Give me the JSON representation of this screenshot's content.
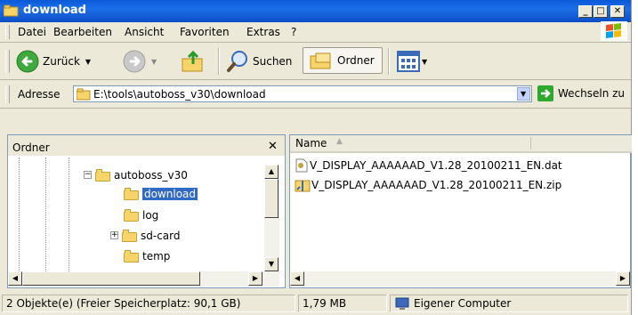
{
  "window": {
    "title": "download"
  },
  "menu": {
    "items": [
      {
        "label": "Datei"
      },
      {
        "label": "Bearbeiten"
      },
      {
        "label": "Ansicht"
      },
      {
        "label": "Favoriten"
      },
      {
        "label": "Extras"
      },
      {
        "label": "?"
      }
    ]
  },
  "toolbar": {
    "back": "Zurück",
    "search": "Suchen",
    "folders": "Ordner"
  },
  "address": {
    "label": "Adresse",
    "value": "E:\\tools\\autoboss_v30\\download",
    "go": "Wechseln zu"
  },
  "folderpane": {
    "title": "Ordner",
    "items": [
      {
        "label": "autoboss_v30",
        "expander": "−"
      },
      {
        "label": "download"
      },
      {
        "label": "log"
      },
      {
        "label": "sd-card",
        "expander": "+"
      },
      {
        "label": "temp"
      }
    ]
  },
  "list": {
    "column": "Name",
    "files": [
      {
        "name": "V_DISPLAY_AAAAAAD_V1.28_20100211_EN.dat",
        "icon": "dat-file-icon"
      },
      {
        "name": "V_DISPLAY_AAAAAAD_V1.28_20100211_EN.zip",
        "icon": "zip-file-icon"
      }
    ]
  },
  "status": {
    "objects": "2 Objekte(e) (Freier Speicherplatz: 90,1 GB)",
    "size": "1,79 MB",
    "zone": "Eigener Computer"
  },
  "colors": {
    "titlebar": "#0a5ad8",
    "selection": "#316ac5",
    "chrome": "#ece9d8"
  }
}
